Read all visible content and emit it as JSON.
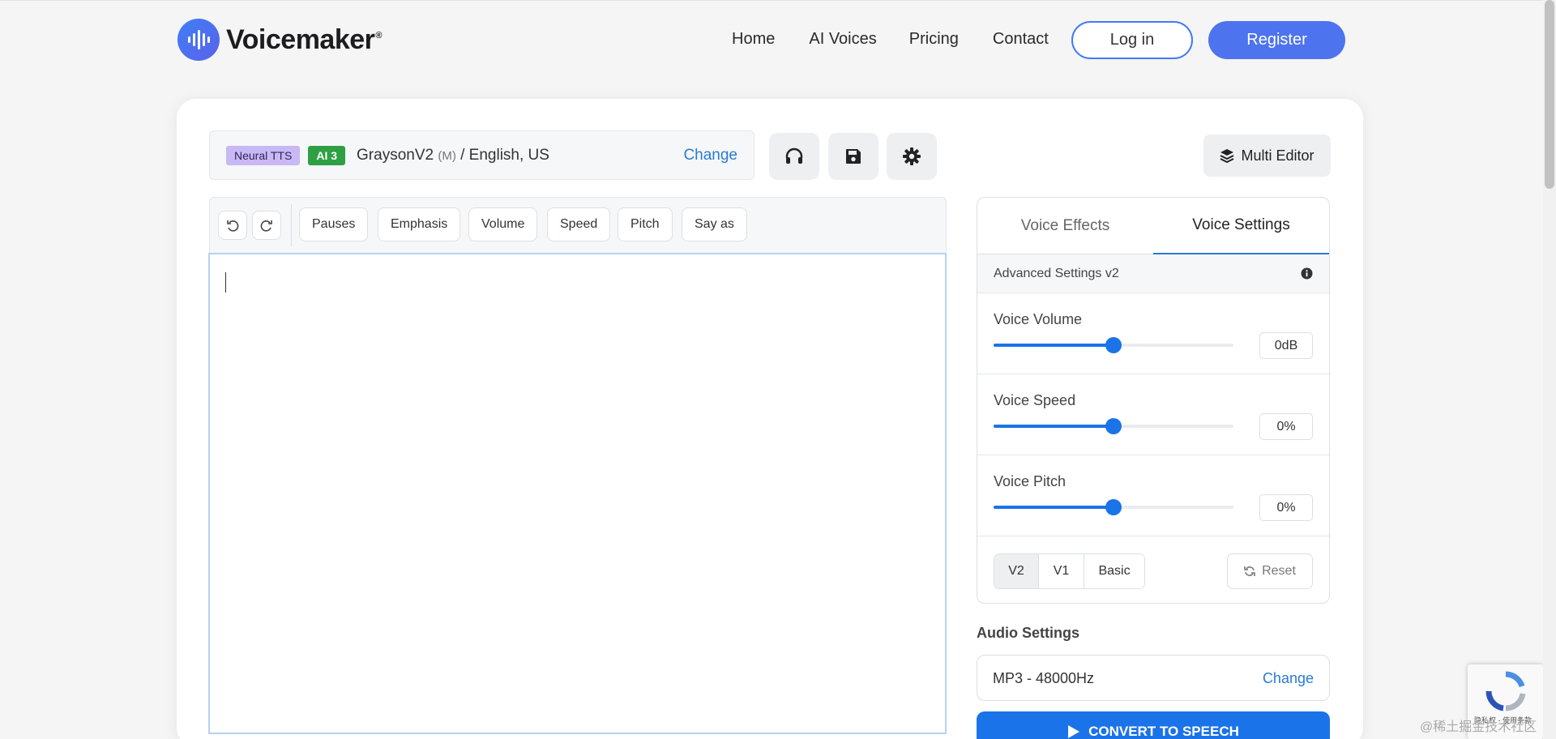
{
  "brand": {
    "name": "Voicemaker",
    "reg": "®"
  },
  "nav": {
    "links": [
      "Home",
      "AI Voices",
      "Pricing",
      "Contact"
    ],
    "login_label": "Log in",
    "register_label": "Register"
  },
  "voice": {
    "badge_neural": "Neural TTS",
    "badge_ai": "AI 3",
    "name": "GraysonV2",
    "gender": "(M)",
    "language": "/ English, US",
    "change_label": "Change"
  },
  "toolbar": {
    "buttons": [
      "Pauses",
      "Emphasis",
      "Volume",
      "Speed",
      "Pitch",
      "Say as"
    ],
    "multi_editor_label": "Multi Editor"
  },
  "editor": {
    "text": ""
  },
  "panel": {
    "tabs": [
      "Voice Effects",
      "Voice Settings"
    ],
    "active_tab": "Voice Settings",
    "advanced_label": "Advanced Settings v2",
    "sliders": [
      {
        "label": "Voice Volume",
        "value": "0dB",
        "fraction": 0.5
      },
      {
        "label": "Voice Speed",
        "value": "0%",
        "fraction": 0.5
      },
      {
        "label": "Voice Pitch",
        "value": "0%",
        "fraction": 0.5
      }
    ],
    "versions": [
      "V2",
      "V1",
      "Basic"
    ],
    "active_version": "V2",
    "reset_label": "Reset"
  },
  "audio": {
    "title": "Audio Settings",
    "format": "MP3 - 48000Hz",
    "change_label": "Change"
  },
  "convert_label": "CONVERT TO SPEECH",
  "overlays": {
    "recaptcha_text": "隐私权 - 使用条款",
    "watermark": "@稀土掘金技术社区"
  },
  "colors": {
    "accent": "#1a73e8",
    "register": "#4e73ee",
    "link": "#2a7bd3",
    "badge_ai": "#2ea043",
    "badge_neural": "#c8b8f5"
  }
}
